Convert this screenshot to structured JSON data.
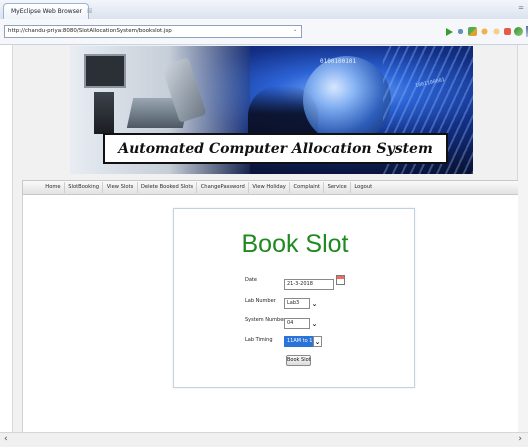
{
  "browser": {
    "tab_title": "MyEclipse Web Browser",
    "tab_close": "☒",
    "url": "http://chandu-priya:8080/SlotAllocationSystem/bookslot.jsp",
    "url_dropdown": "⌄"
  },
  "banner": {
    "title": "Automated Computer Allocation System",
    "binary_1": "0100100101",
    "binary_2": "1001100001"
  },
  "nav": {
    "items": [
      "Home",
      "SlotBooking",
      "View Slots",
      "Delete Booked Slots",
      "ChangePassword",
      "View Holiday",
      "Complaint",
      "Service",
      "Logout"
    ]
  },
  "form": {
    "title": "Book Slot",
    "date_label": "Date",
    "date_value": "21-3-2018",
    "lab_number_label": "Lab Number",
    "lab_number_value": "Lab3",
    "system_number_label": "System Number",
    "system_number_value": "04",
    "lab_timing_label": "Lab Timing",
    "lab_timing_value": "11AM to 1PM",
    "submit_label": "Book Slot"
  },
  "colors": {
    "title_green": "#1f8a1f",
    "selected_blue": "#2a73d9"
  },
  "scroll": {
    "left_arrow": "‹",
    "right_arrow": "›"
  }
}
